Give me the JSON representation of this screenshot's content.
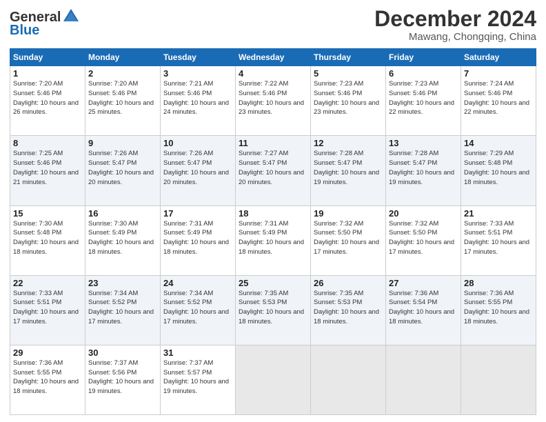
{
  "header": {
    "logo_line1": "General",
    "logo_line2": "Blue",
    "month": "December 2024",
    "location": "Mawang, Chongqing, China"
  },
  "weekdays": [
    "Sunday",
    "Monday",
    "Tuesday",
    "Wednesday",
    "Thursday",
    "Friday",
    "Saturday"
  ],
  "weeks": [
    [
      {
        "day": "1",
        "sunrise": "Sunrise: 7:20 AM",
        "sunset": "Sunset: 5:46 PM",
        "daylight": "Daylight: 10 hours and 26 minutes."
      },
      {
        "day": "2",
        "sunrise": "Sunrise: 7:20 AM",
        "sunset": "Sunset: 5:46 PM",
        "daylight": "Daylight: 10 hours and 25 minutes."
      },
      {
        "day": "3",
        "sunrise": "Sunrise: 7:21 AM",
        "sunset": "Sunset: 5:46 PM",
        "daylight": "Daylight: 10 hours and 24 minutes."
      },
      {
        "day": "4",
        "sunrise": "Sunrise: 7:22 AM",
        "sunset": "Sunset: 5:46 PM",
        "daylight": "Daylight: 10 hours and 23 minutes."
      },
      {
        "day": "5",
        "sunrise": "Sunrise: 7:23 AM",
        "sunset": "Sunset: 5:46 PM",
        "daylight": "Daylight: 10 hours and 23 minutes."
      },
      {
        "day": "6",
        "sunrise": "Sunrise: 7:23 AM",
        "sunset": "Sunset: 5:46 PM",
        "daylight": "Daylight: 10 hours and 22 minutes."
      },
      {
        "day": "7",
        "sunrise": "Sunrise: 7:24 AM",
        "sunset": "Sunset: 5:46 PM",
        "daylight": "Daylight: 10 hours and 22 minutes."
      }
    ],
    [
      {
        "day": "8",
        "sunrise": "Sunrise: 7:25 AM",
        "sunset": "Sunset: 5:46 PM",
        "daylight": "Daylight: 10 hours and 21 minutes."
      },
      {
        "day": "9",
        "sunrise": "Sunrise: 7:26 AM",
        "sunset": "Sunset: 5:47 PM",
        "daylight": "Daylight: 10 hours and 20 minutes."
      },
      {
        "day": "10",
        "sunrise": "Sunrise: 7:26 AM",
        "sunset": "Sunset: 5:47 PM",
        "daylight": "Daylight: 10 hours and 20 minutes."
      },
      {
        "day": "11",
        "sunrise": "Sunrise: 7:27 AM",
        "sunset": "Sunset: 5:47 PM",
        "daylight": "Daylight: 10 hours and 20 minutes."
      },
      {
        "day": "12",
        "sunrise": "Sunrise: 7:28 AM",
        "sunset": "Sunset: 5:47 PM",
        "daylight": "Daylight: 10 hours and 19 minutes."
      },
      {
        "day": "13",
        "sunrise": "Sunrise: 7:28 AM",
        "sunset": "Sunset: 5:47 PM",
        "daylight": "Daylight: 10 hours and 19 minutes."
      },
      {
        "day": "14",
        "sunrise": "Sunrise: 7:29 AM",
        "sunset": "Sunset: 5:48 PM",
        "daylight": "Daylight: 10 hours and 18 minutes."
      }
    ],
    [
      {
        "day": "15",
        "sunrise": "Sunrise: 7:30 AM",
        "sunset": "Sunset: 5:48 PM",
        "daylight": "Daylight: 10 hours and 18 minutes."
      },
      {
        "day": "16",
        "sunrise": "Sunrise: 7:30 AM",
        "sunset": "Sunset: 5:49 PM",
        "daylight": "Daylight: 10 hours and 18 minutes."
      },
      {
        "day": "17",
        "sunrise": "Sunrise: 7:31 AM",
        "sunset": "Sunset: 5:49 PM",
        "daylight": "Daylight: 10 hours and 18 minutes."
      },
      {
        "day": "18",
        "sunrise": "Sunrise: 7:31 AM",
        "sunset": "Sunset: 5:49 PM",
        "daylight": "Daylight: 10 hours and 18 minutes."
      },
      {
        "day": "19",
        "sunrise": "Sunrise: 7:32 AM",
        "sunset": "Sunset: 5:50 PM",
        "daylight": "Daylight: 10 hours and 17 minutes."
      },
      {
        "day": "20",
        "sunrise": "Sunrise: 7:32 AM",
        "sunset": "Sunset: 5:50 PM",
        "daylight": "Daylight: 10 hours and 17 minutes."
      },
      {
        "day": "21",
        "sunrise": "Sunrise: 7:33 AM",
        "sunset": "Sunset: 5:51 PM",
        "daylight": "Daylight: 10 hours and 17 minutes."
      }
    ],
    [
      {
        "day": "22",
        "sunrise": "Sunrise: 7:33 AM",
        "sunset": "Sunset: 5:51 PM",
        "daylight": "Daylight: 10 hours and 17 minutes."
      },
      {
        "day": "23",
        "sunrise": "Sunrise: 7:34 AM",
        "sunset": "Sunset: 5:52 PM",
        "daylight": "Daylight: 10 hours and 17 minutes."
      },
      {
        "day": "24",
        "sunrise": "Sunrise: 7:34 AM",
        "sunset": "Sunset: 5:52 PM",
        "daylight": "Daylight: 10 hours and 17 minutes."
      },
      {
        "day": "25",
        "sunrise": "Sunrise: 7:35 AM",
        "sunset": "Sunset: 5:53 PM",
        "daylight": "Daylight: 10 hours and 18 minutes."
      },
      {
        "day": "26",
        "sunrise": "Sunrise: 7:35 AM",
        "sunset": "Sunset: 5:53 PM",
        "daylight": "Daylight: 10 hours and 18 minutes."
      },
      {
        "day": "27",
        "sunrise": "Sunrise: 7:36 AM",
        "sunset": "Sunset: 5:54 PM",
        "daylight": "Daylight: 10 hours and 18 minutes."
      },
      {
        "day": "28",
        "sunrise": "Sunrise: 7:36 AM",
        "sunset": "Sunset: 5:55 PM",
        "daylight": "Daylight: 10 hours and 18 minutes."
      }
    ],
    [
      {
        "day": "29",
        "sunrise": "Sunrise: 7:36 AM",
        "sunset": "Sunset: 5:55 PM",
        "daylight": "Daylight: 10 hours and 18 minutes."
      },
      {
        "day": "30",
        "sunrise": "Sunrise: 7:37 AM",
        "sunset": "Sunset: 5:56 PM",
        "daylight": "Daylight: 10 hours and 19 minutes."
      },
      {
        "day": "31",
        "sunrise": "Sunrise: 7:37 AM",
        "sunset": "Sunset: 5:57 PM",
        "daylight": "Daylight: 10 hours and 19 minutes."
      },
      null,
      null,
      null,
      null
    ]
  ]
}
